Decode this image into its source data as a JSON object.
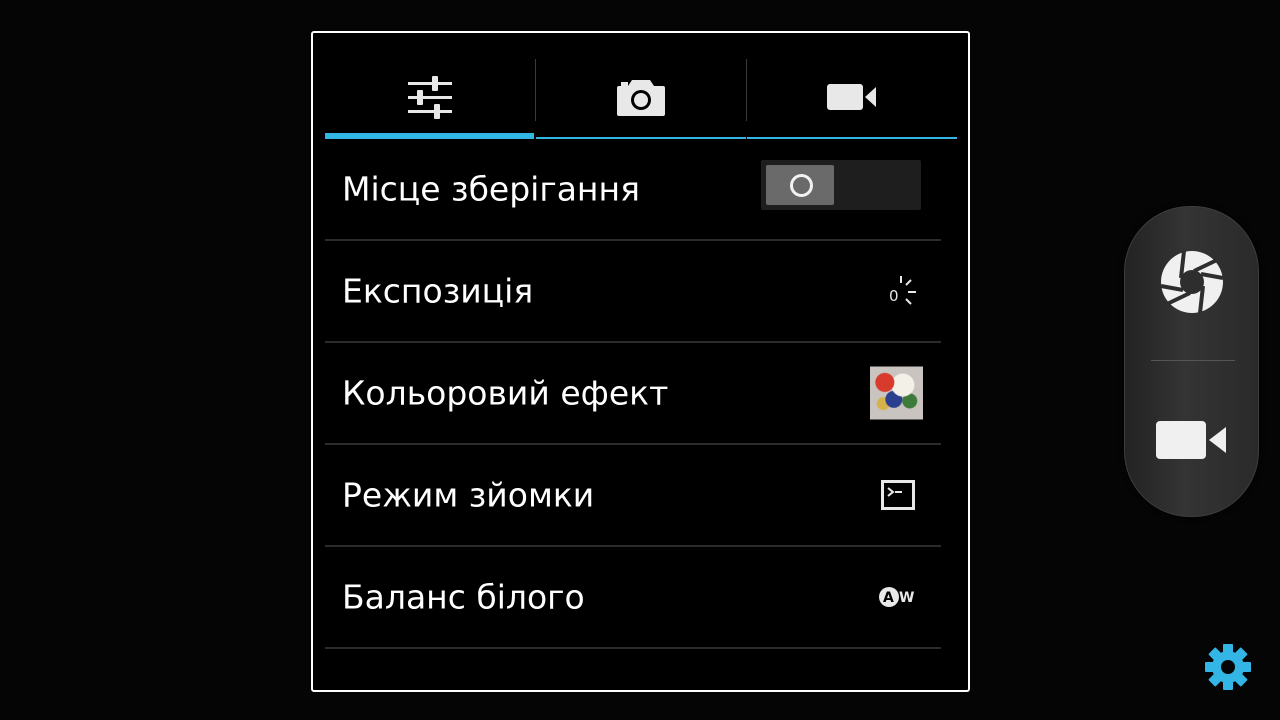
{
  "tabs": [
    {
      "name": "settings-sliders-icon",
      "active": true
    },
    {
      "name": "camera-icon",
      "active": false
    },
    {
      "name": "video-camera-icon",
      "active": false
    }
  ],
  "settings": {
    "storage_location": {
      "label": "Місце зберігання",
      "toggle_on": false
    },
    "exposure": {
      "label": "Експозиція",
      "value": "0"
    },
    "color_effect": {
      "label": "Кольоровий ефект"
    },
    "scene_mode": {
      "label": "Режим зйомки"
    },
    "white_balance": {
      "label": "Баланс білого",
      "value": "AW"
    }
  },
  "mode_switcher": {
    "photo_icon": "shutter-icon",
    "video_icon": "video-camera-icon"
  },
  "settings_button_icon": "gear-icon",
  "colors": {
    "accent": "#33b5e5",
    "background": "#000000",
    "text": "#ffffff"
  }
}
